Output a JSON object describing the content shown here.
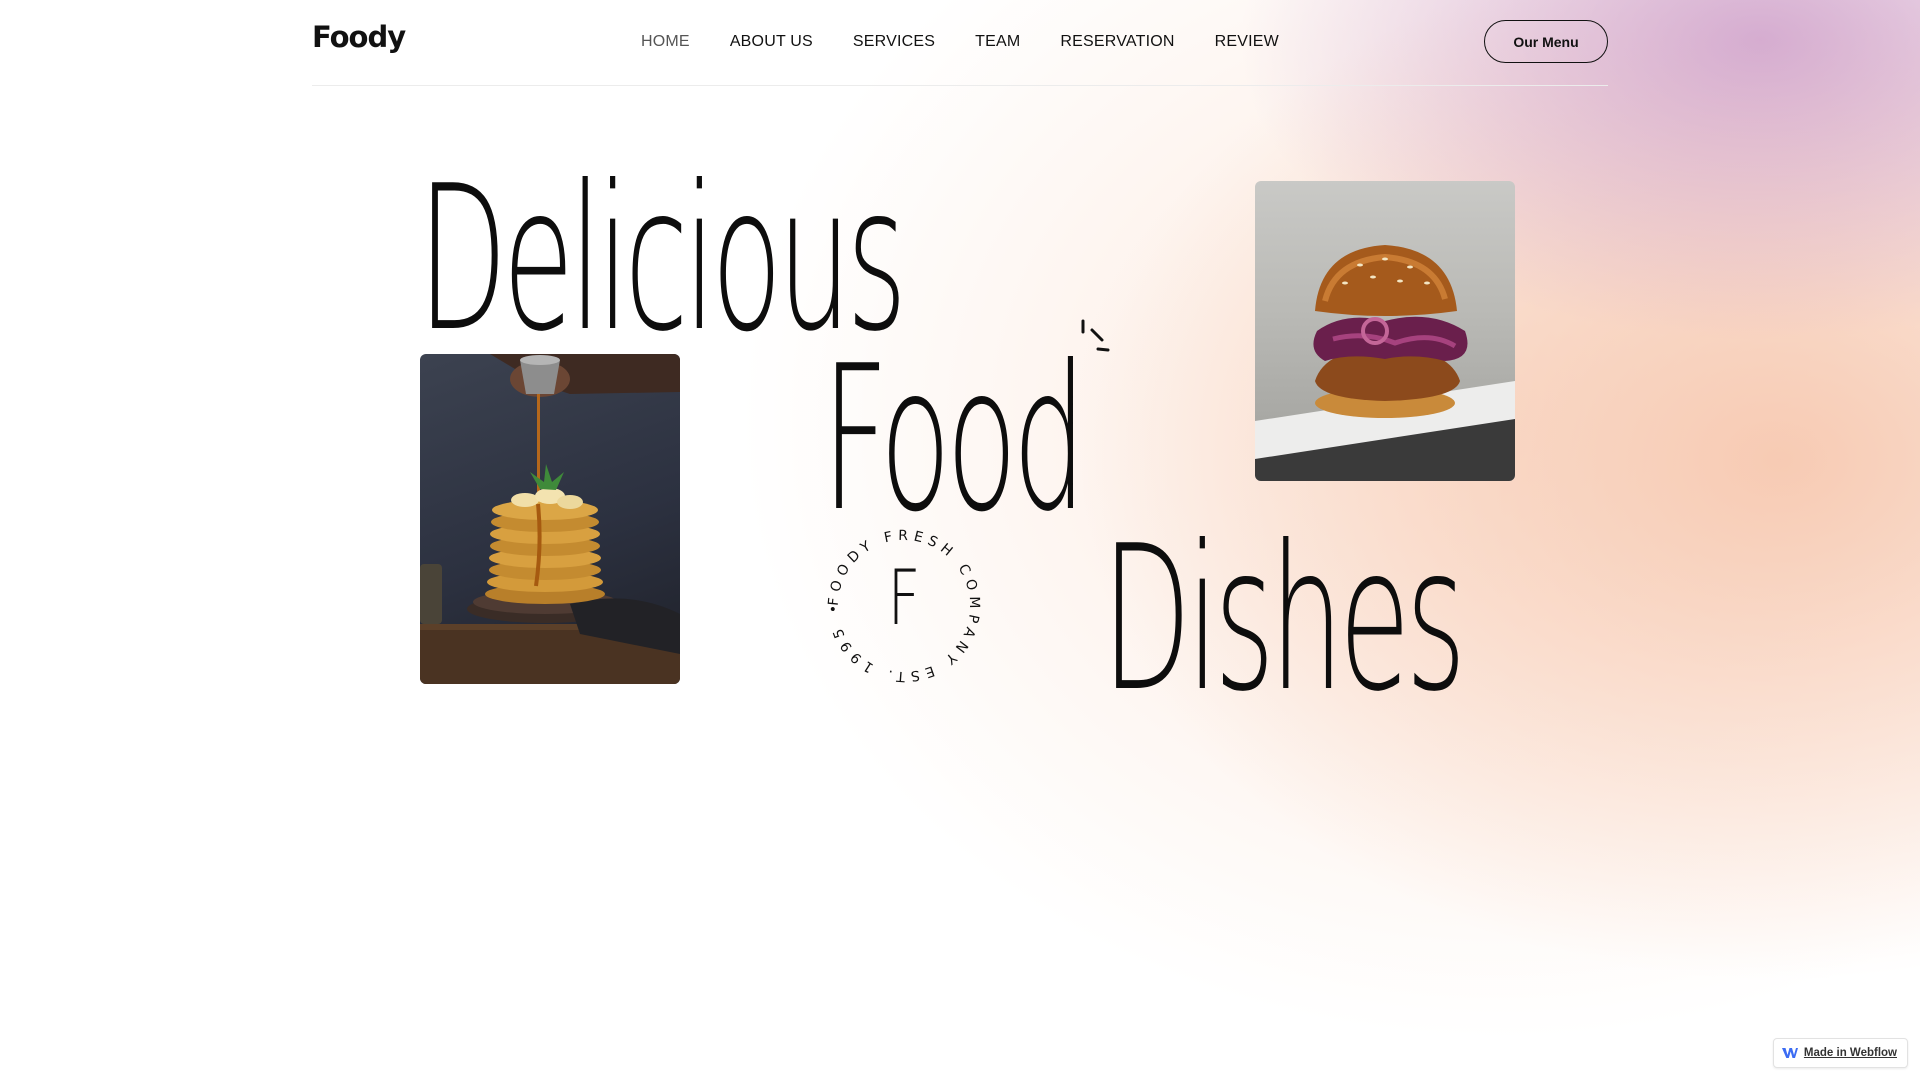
{
  "nav": {
    "logo": "Foody",
    "links": [
      {
        "label": "HOME",
        "active": true
      },
      {
        "label": "ABOUT US",
        "active": false
      },
      {
        "label": "SERVICES",
        "active": false
      },
      {
        "label": "TEAM",
        "active": false
      },
      {
        "label": "RESERVATION",
        "active": false
      },
      {
        "label": "REVIEW",
        "active": false
      }
    ],
    "cta_label": "Our Menu"
  },
  "hero": {
    "word1": "Delicious",
    "word2": "Food",
    "word3": "Dishes",
    "badge_letter": "F",
    "badge_ring_text": "FOODY FRESH COMPANY EST. 1995 •"
  },
  "images": {
    "pancake_icon": "pancake-photo",
    "burger_icon": "burger-photo"
  },
  "footer_badge": {
    "label": "Made in Webflow",
    "icon": "webflow-icon"
  },
  "colors": {
    "text": "#111111",
    "gradient_pink": "#c896c8",
    "gradient_peach": "#f6c4aa"
  }
}
